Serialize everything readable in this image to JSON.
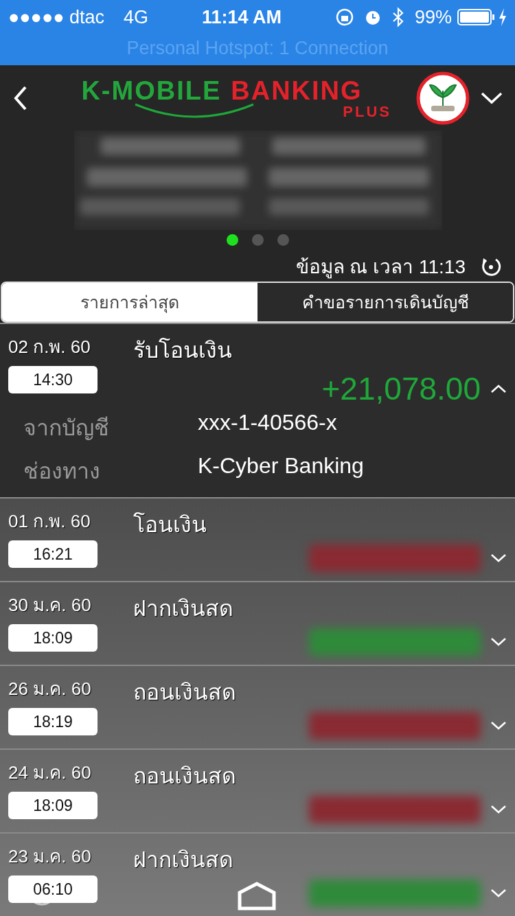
{
  "status_bar": {
    "carrier": "●●●●● dtac",
    "network": "4G",
    "time": "11:14 AM",
    "battery": "99%",
    "hotspot": "Personal Hotspot: 1 Connection"
  },
  "header": {
    "logo_primary": "K-MOBILE",
    "logo_secondary": "BANKING",
    "logo_sub": "PLUS"
  },
  "carousel": {
    "pages": [
      {
        "selected": true
      },
      {
        "selected": false
      },
      {
        "selected": false
      }
    ]
  },
  "timestamp": "ข้อมูล ณ เวลา 11:13",
  "tabs": [
    {
      "label": "รายการล่าสุด",
      "selected": true
    },
    {
      "label": "คำขอรายการเดินบัญชี",
      "selected": false
    }
  ],
  "transactions": [
    {
      "date": "02 ก.พ. 60",
      "time": "14:30",
      "title": "รับโอนเงิน",
      "color": "#1fa83a",
      "expanded": true,
      "amount": "+21,078.00",
      "details": [
        {
          "label": "จากบัญชี",
          "value": "xxx-1-40566-x"
        },
        {
          "label": "ช่องทาง",
          "value": "K-Cyber Banking"
        }
      ]
    },
    {
      "date": "01 ก.พ. 60",
      "time": "16:21",
      "title": "โอนเงิน",
      "color": "#8a2a32",
      "expanded": false
    },
    {
      "date": "30 ม.ค. 60",
      "time": "18:09",
      "title": "ฝากเงินสด",
      "color": "#2f8a3a",
      "expanded": false
    },
    {
      "date": "26 ม.ค. 60",
      "time": "18:19",
      "title": "ถอนเงินสด",
      "color": "#8a2a32",
      "expanded": false
    },
    {
      "date": "24 ม.ค. 60",
      "time": "18:09",
      "title": "ถอนเงินสด",
      "color": "#8a2a32",
      "expanded": false
    },
    {
      "date": "23 ม.ค. 60",
      "time": "06:10",
      "title": "ฝากเงินสด",
      "color": "#2f8a3a",
      "expanded": false
    }
  ]
}
